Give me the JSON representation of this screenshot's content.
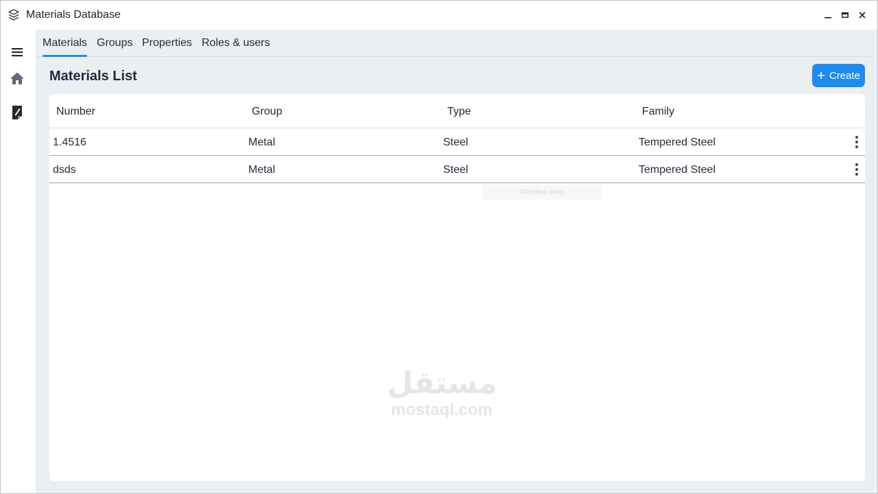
{
  "window": {
    "title": "Materials Database",
    "icons": {
      "app": "layers-icon",
      "minimize": "minimize-icon",
      "maximize": "maximize-icon",
      "close": "close-icon"
    }
  },
  "sidebar": {
    "items": [
      {
        "icon": "menu-icon"
      },
      {
        "icon": "home-icon"
      },
      {
        "icon": "document-edit-icon"
      }
    ]
  },
  "tabs": [
    {
      "label": "Materials",
      "active": true
    },
    {
      "label": "Groups",
      "active": false
    },
    {
      "label": "Properties",
      "active": false
    },
    {
      "label": "Roles & users",
      "active": false
    }
  ],
  "page": {
    "title": "Materials List",
    "create_label": "Create",
    "create_icon": "plus-icon"
  },
  "table": {
    "columns": [
      "Number",
      "Group",
      "Type",
      "Family"
    ],
    "rows": [
      {
        "number": "1.4516",
        "group": "Metal",
        "type": "Steel",
        "family": "Tempered Steel"
      },
      {
        "number": "dsds",
        "group": "Metal",
        "type": "Steel",
        "family": "Tempered Steel"
      }
    ],
    "row_action_icon": "more-vertical-icon"
  },
  "overlay": {
    "snip_hint": "Window Snip",
    "watermark_arabic": "مستقل",
    "watermark_latin": "mostaql.com"
  },
  "colors": {
    "accent": "#1d8cf0",
    "background": "#eceff1",
    "card": "#ffffff",
    "text": "#1f2a3a"
  }
}
